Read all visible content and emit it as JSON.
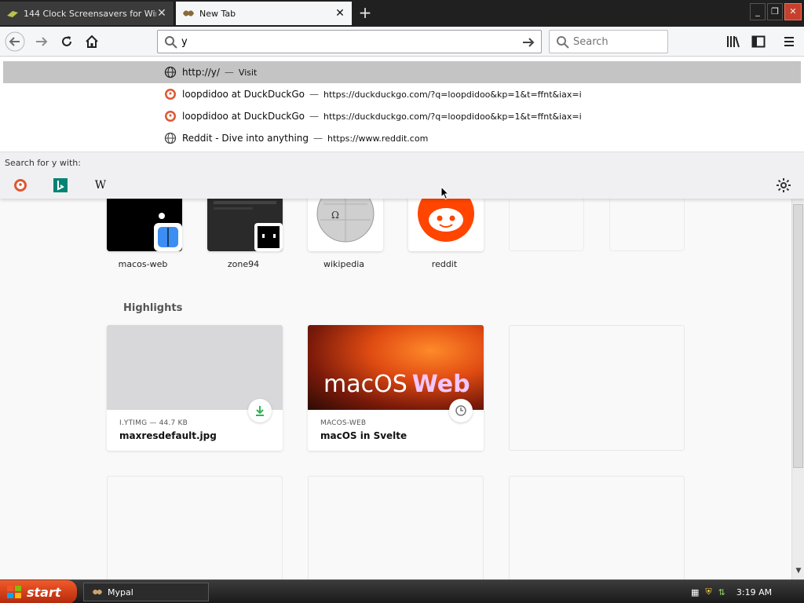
{
  "tabs": [
    {
      "title": "144 Clock Screensavers for Windows",
      "active": false
    },
    {
      "title": "New Tab",
      "active": true
    }
  ],
  "urlbar": {
    "value": "y"
  },
  "searchbar": {
    "placeholder": "Search"
  },
  "dropdown": {
    "rows": [
      {
        "title": "http://y/",
        "separator": "—",
        "sub": "Visit",
        "icon": "globe-icon"
      },
      {
        "title": "loopdidoo at DuckDuckGo",
        "separator": "—",
        "sub": "https://duckduckgo.com/?q=loopdidoo&kp=1&t=ffnt&iax=i",
        "icon": "duckduckgo-icon"
      },
      {
        "title": "loopdidoo at DuckDuckGo",
        "separator": "—",
        "sub": "https://duckduckgo.com/?q=loopdidoo&kp=1&t=ffnt&iax=i",
        "icon": "duckduckgo-icon"
      },
      {
        "title": "Reddit - Dive into anything",
        "separator": "—",
        "sub": "https://www.reddit.com",
        "icon": "globe-icon"
      }
    ],
    "search_with_label": "Search for y with:"
  },
  "top_sites": [
    {
      "label": "macos-web"
    },
    {
      "label": "zone94"
    },
    {
      "label": "wikipedia"
    },
    {
      "label": "reddit"
    }
  ],
  "highlights": {
    "title": "Highlights",
    "cards": [
      {
        "meta": "I.YTIMG — 44.7 KB",
        "title": "maxresdefault.jpg"
      },
      {
        "meta": "MACOS-WEB",
        "title": "macOS in Svelte",
        "thumb_text_1": "macOS",
        "thumb_text_2": "Web"
      }
    ]
  },
  "taskbar": {
    "start_label": "start",
    "task": "Mypal",
    "clock": "3:19 AM"
  },
  "colors": {
    "accent": "#0a84ff",
    "selected_row": "#c4c4c4",
    "reddit": "#ff4500",
    "download": "#2fb354"
  }
}
